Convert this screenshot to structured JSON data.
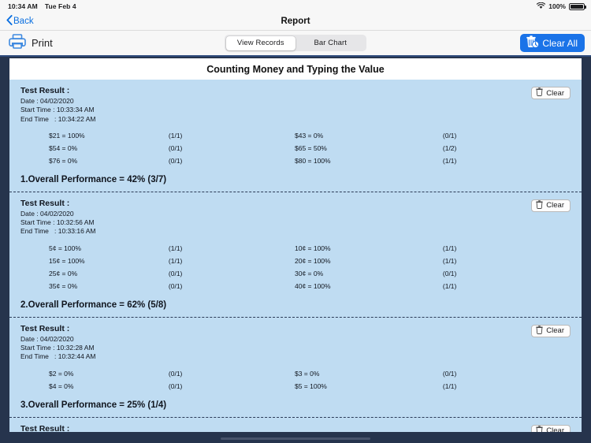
{
  "statusbar": {
    "time": "10:34 AM",
    "date": "Tue Feb 4",
    "battery_percent": "100%",
    "wifi_icon": "wifi-icon",
    "battery_icon": "battery-icon"
  },
  "navbar": {
    "back_label": "Back",
    "back_icon": "chevron-left-icon",
    "title": "Report"
  },
  "toolbar": {
    "print_label": "Print",
    "print_icon": "printer-icon",
    "clear_all_label": "Clear All",
    "clear_all_icon": "trash-clock-icon",
    "clear_all_color": "#1a73e8",
    "segments": [
      {
        "label": "View Records",
        "selected": true
      },
      {
        "label": "Bar Chart",
        "selected": false
      }
    ]
  },
  "report": {
    "title": "Counting Money and Typing the Value",
    "clear_label": "Clear",
    "clear_icon": "trash-icon",
    "labels": {
      "test_result": "Test Result :",
      "date_prefix": "Date : ",
      "start_prefix": "Start Time : ",
      "end_prefix": "End Time   : "
    },
    "records": [
      {
        "date": "04/02/2020",
        "start_time": "10:33:34 AM",
        "end_time": "10:34:22 AM",
        "rows": [
          {
            "left_item": "$21 = 100%",
            "left_score": "(1/1)",
            "right_item": "$43 = 0%",
            "right_score": "(0/1)"
          },
          {
            "left_item": "$54 = 0%",
            "left_score": "(0/1)",
            "right_item": "$65 = 50%",
            "right_score": "(1/2)"
          },
          {
            "left_item": "$76 = 0%",
            "left_score": "(0/1)",
            "right_item": "$80 = 100%",
            "right_score": "(1/1)"
          }
        ],
        "performance": "1.Overall Performance = 42% (3/7)"
      },
      {
        "date": "04/02/2020",
        "start_time": "10:32:56 AM",
        "end_time": "10:33:16 AM",
        "rows": [
          {
            "left_item": "5¢ = 100%",
            "left_score": "(1/1)",
            "right_item": "10¢ = 100%",
            "right_score": "(1/1)"
          },
          {
            "left_item": "15¢ = 100%",
            "left_score": "(1/1)",
            "right_item": "20¢ = 100%",
            "right_score": "(1/1)"
          },
          {
            "left_item": "25¢ = 0%",
            "left_score": "(0/1)",
            "right_item": "30¢ = 0%",
            "right_score": "(0/1)"
          },
          {
            "left_item": "35¢ = 0%",
            "left_score": "(0/1)",
            "right_item": "40¢ = 100%",
            "right_score": "(1/1)"
          }
        ],
        "performance": "2.Overall Performance = 62% (5/8)"
      },
      {
        "date": "04/02/2020",
        "start_time": "10:32:28 AM",
        "end_time": "10:32:44 AM",
        "rows": [
          {
            "left_item": "$2 = 0%",
            "left_score": "(0/1)",
            "right_item": "$3 = 0%",
            "right_score": "(0/1)"
          },
          {
            "left_item": "$4 = 0%",
            "left_score": "(0/1)",
            "right_item": "$5 = 100%",
            "right_score": "(1/1)"
          }
        ],
        "performance": "3.Overall Performance = 25% (1/4)"
      },
      {
        "date": "",
        "start_time": "",
        "end_time": "",
        "rows": [],
        "performance": ""
      }
    ]
  }
}
